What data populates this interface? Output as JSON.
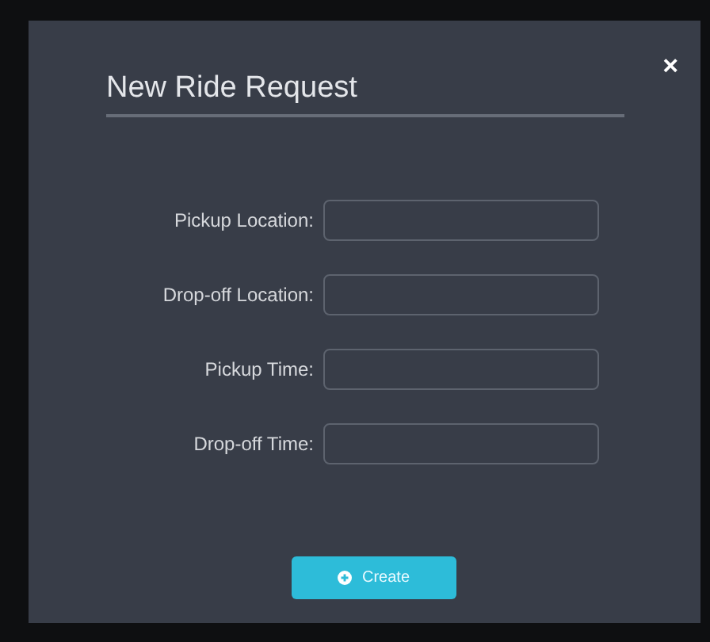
{
  "dialog": {
    "title": "New Ride Request",
    "close": "×",
    "fields": [
      {
        "label": "Pickup Location:"
      },
      {
        "label": "Drop-off Location:"
      },
      {
        "label": "Pickup Time:"
      },
      {
        "label": "Drop-off Time:"
      }
    ],
    "submit": {
      "label": "Create"
    }
  }
}
